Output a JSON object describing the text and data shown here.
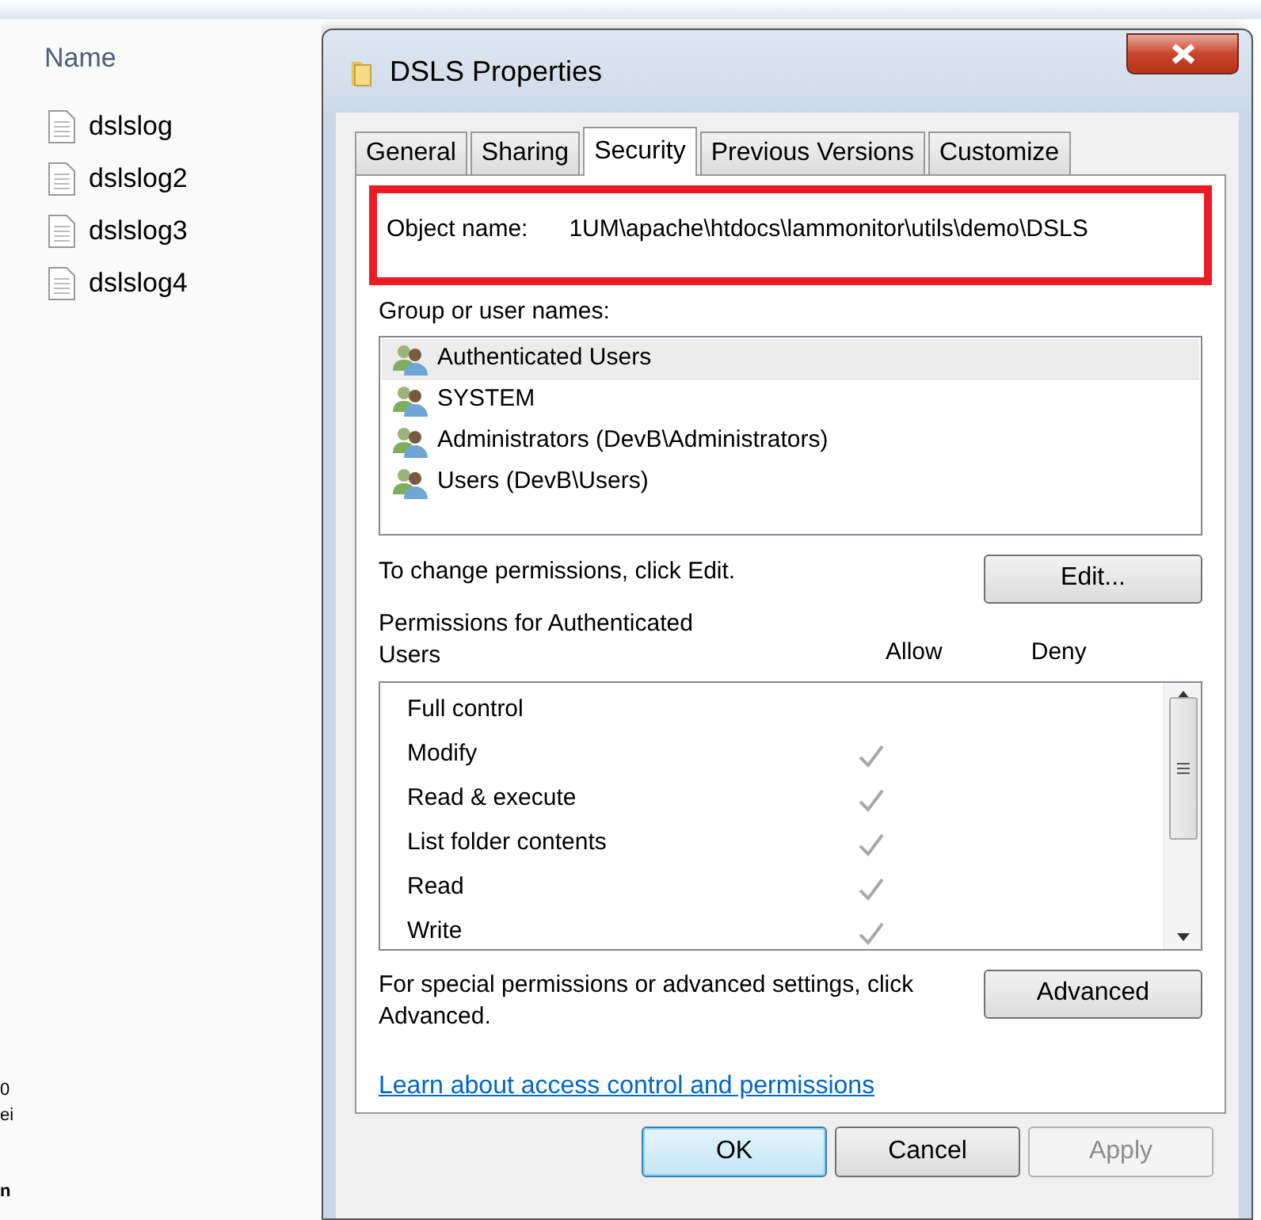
{
  "explorer": {
    "column_header": "Name",
    "files": [
      {
        "name": "dslslog"
      },
      {
        "name": "dslslog2"
      },
      {
        "name": "dslslog3"
      },
      {
        "name": "dslslog4"
      }
    ],
    "edge_fragments": [
      "0",
      "ei",
      "n"
    ]
  },
  "dialog": {
    "title": "DSLS Properties",
    "tabs": [
      {
        "label": "General",
        "selected": false
      },
      {
        "label": "Sharing",
        "selected": false
      },
      {
        "label": "Security",
        "selected": true
      },
      {
        "label": "Previous Versions",
        "selected": false
      },
      {
        "label": "Customize",
        "selected": false
      }
    ],
    "object_name": {
      "label": "Object name:",
      "value": "1UM\\apache\\htdocs\\lammonitor\\utils\\demo\\DSLS",
      "highlighted": true
    },
    "groups_label": "Group or user names:",
    "groups": [
      {
        "name": "Authenticated Users",
        "selected": true
      },
      {
        "name": "SYSTEM",
        "selected": false
      },
      {
        "name": "Administrators (DevB\\Administrators)",
        "selected": false
      },
      {
        "name": "Users (DevB\\Users)",
        "selected": false
      }
    ],
    "change_text": "To change permissions, click Edit.",
    "edit_button": "Edit...",
    "permissions_label": "Permissions for Authenticated Users",
    "allow_header": "Allow",
    "deny_header": "Deny",
    "permissions": [
      {
        "name": "Full control",
        "allow": false
      },
      {
        "name": "Modify",
        "allow": true
      },
      {
        "name": "Read & execute",
        "allow": true
      },
      {
        "name": "List folder contents",
        "allow": true
      },
      {
        "name": "Read",
        "allow": true
      },
      {
        "name": "Write",
        "allow": true
      }
    ],
    "advanced_text": "For special permissions or advanced settings, click Advanced.",
    "advanced_button": "Advanced",
    "link": "Learn about access control and permissions",
    "buttons": [
      {
        "label": "OK",
        "kind": "default",
        "disabled": false
      },
      {
        "label": "Cancel",
        "kind": "normal",
        "disabled": false
      },
      {
        "label": "Apply",
        "kind": "normal",
        "disabled": true
      }
    ]
  }
}
